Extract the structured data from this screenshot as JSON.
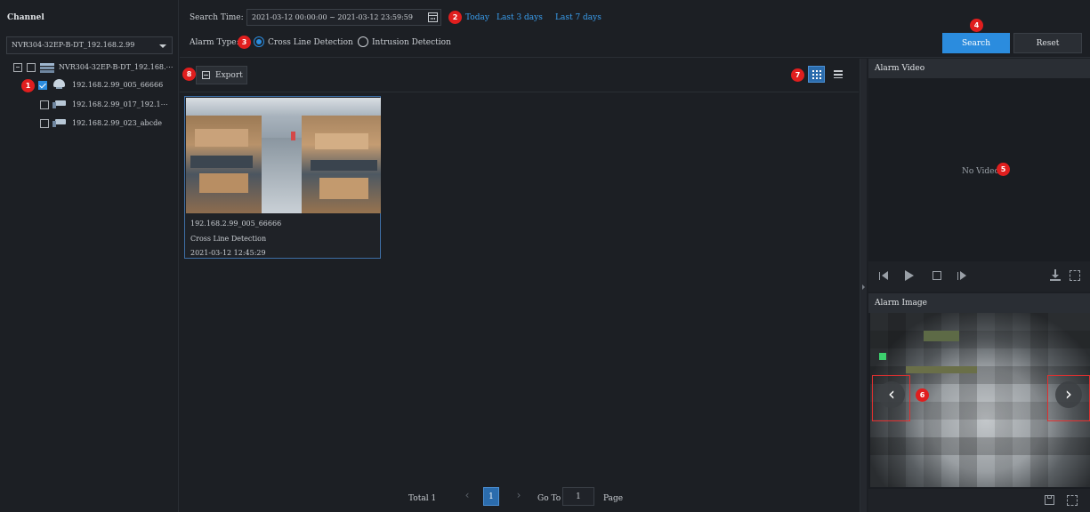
{
  "channel_panel": {
    "title": "Channel",
    "device_select": "NVR304-32EP-B-DT_192.168.2.99",
    "tree": {
      "root_label": "NVR304-32EP-B-DT_192.168.⋯",
      "items": [
        {
          "label": "192.168.2.99_005_66666",
          "checked": true
        },
        {
          "label": "192.168.2.99_017_192.1⋯",
          "checked": false
        },
        {
          "label": "192.168.2.99_023_abcde",
          "checked": false
        }
      ]
    }
  },
  "search_bar": {
    "search_time_label": "Search Time:",
    "time_range": "2021-03-12 00:00:00 ~ 2021-03-12 23:59:59",
    "quick_today": "Today",
    "quick_last3": "Last 3 days",
    "quick_last7": "Last 7 days",
    "alarm_type_label": "Alarm Type:",
    "alarm_type_cross": "Cross Line Detection",
    "alarm_type_intrusion": "Intrusion Detection",
    "search_button": "Search",
    "reset_button": "Reset"
  },
  "results": {
    "export_button": "Export",
    "card": {
      "channel": "192.168.2.99_005_66666",
      "event": "Cross Line Detection",
      "time": "2021-03-12 12:45:29"
    },
    "pagination": {
      "total_label": "Total 1",
      "current_page": "1",
      "goto_label": "Go To",
      "goto_value": "1",
      "page_label": "Page"
    }
  },
  "right_panel": {
    "alarm_video_title": "Alarm Video",
    "no_video": "No Video",
    "alarm_image_title": "Alarm Image"
  },
  "badges": {
    "b1": "1",
    "b2": "2",
    "b3": "3",
    "b4": "4",
    "b5": "5",
    "b6": "6",
    "b7": "7",
    "b8": "8"
  },
  "colors": {
    "accent": "#2b8cde",
    "badge": "#e01e1e",
    "link": "#3a9ff0",
    "background": "#1c1f24"
  }
}
